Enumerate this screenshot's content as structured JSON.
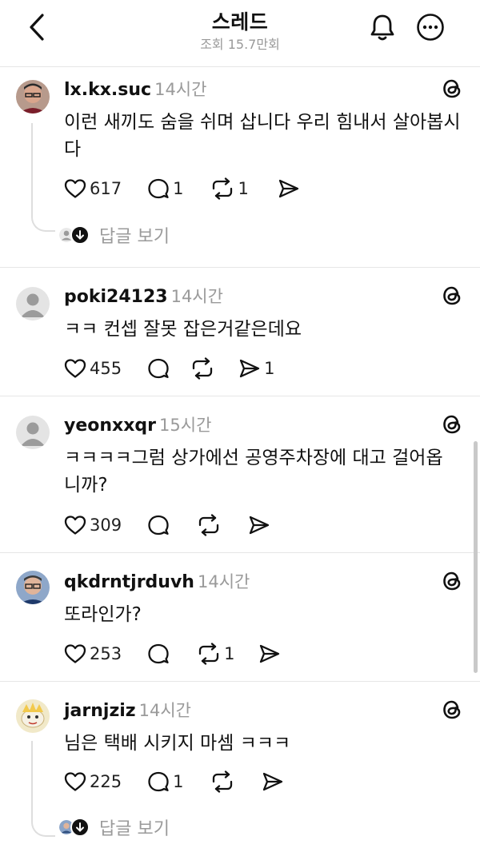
{
  "header": {
    "title": "스레드",
    "views": "조회 15.7만회"
  },
  "comments": [
    {
      "username": "lx.kx.suc",
      "time": "14시간",
      "text": "이런 새끼도 숨을 쉬며 삽니다 우리 힘내서 살아봅시다",
      "likes": "617",
      "replies_count": "1",
      "reposts": "1",
      "shares": "",
      "view_replies": "답글 보기",
      "avatar": "photo-man-glasses"
    },
    {
      "username": "poki24123",
      "time": "14시간",
      "text": "ㅋㅋ 컨셉 잘못 잡은거같은데요",
      "likes": "455",
      "replies_count": "",
      "reposts": "",
      "shares": "1",
      "avatar": "default-person"
    },
    {
      "username": "yeonxxqr",
      "time": "15시간",
      "text": "ㅋㅋㅋㅋ그럼 상가에선 공영주차장에 대고 걸어옵니까?",
      "likes": "309",
      "replies_count": "",
      "reposts": "",
      "shares": "",
      "avatar": "default-person"
    },
    {
      "username": "qkdrntjrduvh",
      "time": "14시간",
      "text": "또라인가?",
      "likes": "253",
      "replies_count": "",
      "reposts": "1",
      "shares": "",
      "avatar": "photo-man-glasses-2"
    },
    {
      "username": "jarnjziz",
      "time": "14시간",
      "text": "님은 택배 시키지 마셈 ㅋㅋㅋ",
      "likes": "225",
      "replies_count": "1",
      "reposts": "",
      "shares": "",
      "view_replies": "답글 보기",
      "avatar": "cartoon-character"
    }
  ],
  "colors": {
    "text": "#111111",
    "muted": "#9a9a9a",
    "divider": "#e6e6e6"
  }
}
